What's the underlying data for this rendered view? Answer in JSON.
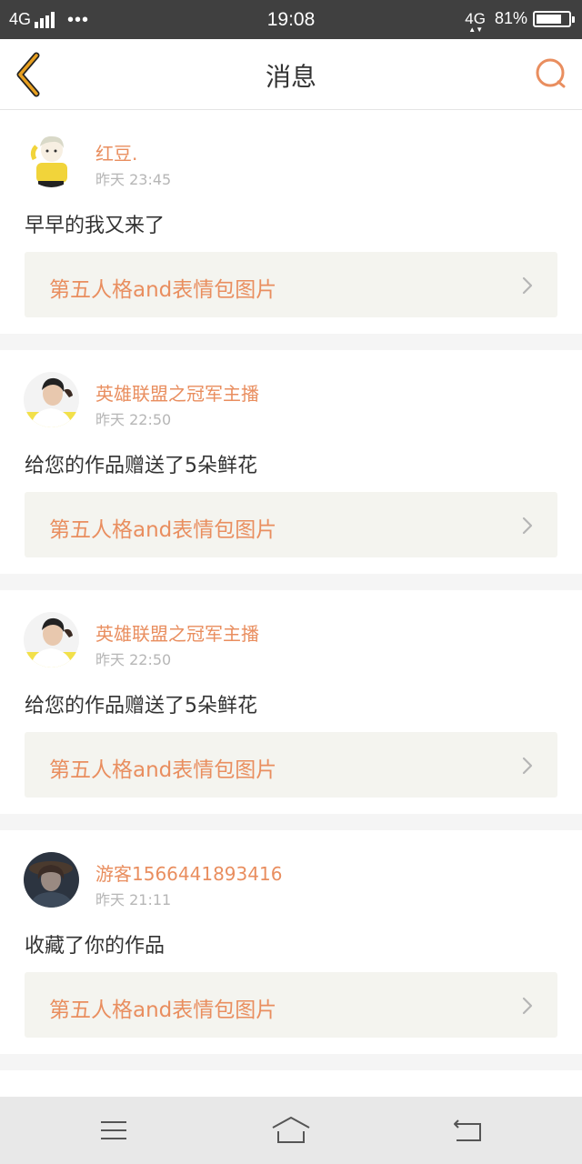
{
  "status_bar": {
    "network": "4G",
    "dots": "•••",
    "time": "19:08",
    "network_right": "4G",
    "battery": "81%",
    "battery_level": 0.81
  },
  "header": {
    "title": "消息",
    "back_icon": "chevron-left-icon",
    "search_icon": "search-icon",
    "accent_color": "#e8a020"
  },
  "messages": [
    {
      "username": "红豆.",
      "time": "昨天 23:45",
      "text": "早早的我又来了",
      "work_title": "第五人格and表情包图片",
      "avatar_icon": "avatar-cartoon-girl"
    },
    {
      "username": "英雄联盟之冠军主播",
      "time": "昨天 22:50",
      "text": "给您的作品赠送了5朵鲜花",
      "work_title": "第五人格and表情包图片",
      "avatar_icon": "avatar-young-man"
    },
    {
      "username": "英雄联盟之冠军主播",
      "time": "昨天 22:50",
      "text": "给您的作品赠送了5朵鲜花",
      "work_title": "第五人格and表情包图片",
      "avatar_icon": "avatar-young-man"
    },
    {
      "username": "游客1566441893416",
      "time": "昨天 21:11",
      "text": "收藏了你的作品",
      "work_title": "第五人格and表情包图片",
      "avatar_icon": "avatar-dark-portrait"
    }
  ],
  "colors": {
    "username": "#e98e5f",
    "link_background": "#f4f4ef",
    "page_background": "#f5f5f5"
  },
  "bottom_nav": {
    "menu_icon": "menu-icon",
    "home_icon": "home-icon",
    "back_icon": "back-icon"
  }
}
